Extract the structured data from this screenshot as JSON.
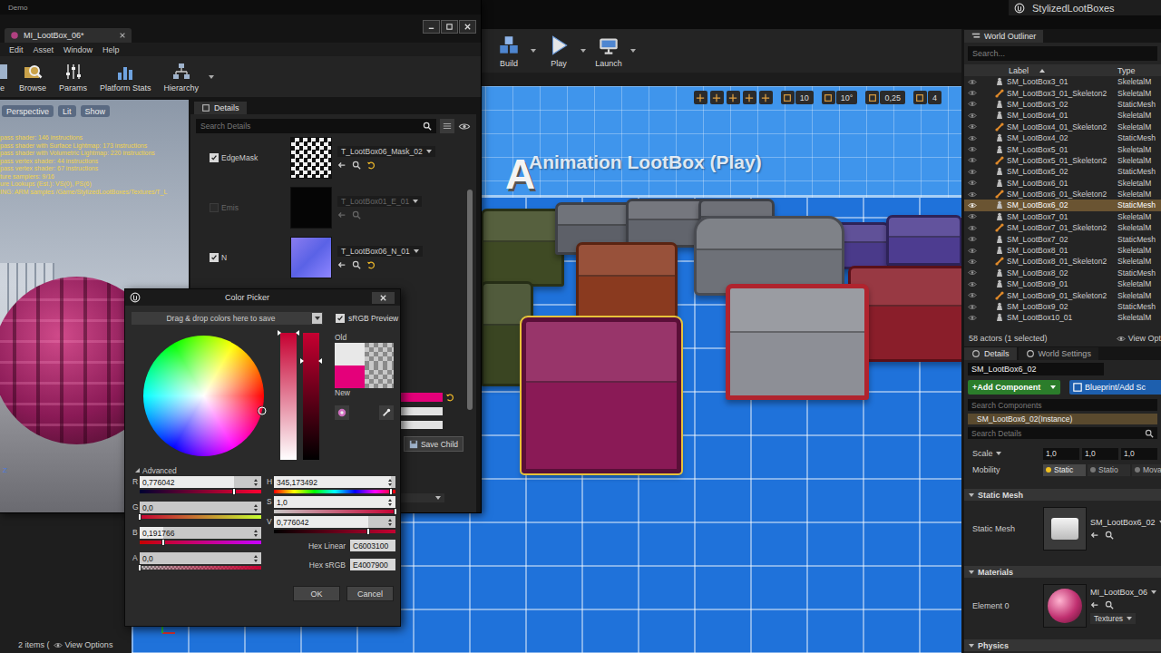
{
  "editor": {
    "project": "StylizedLootBoxes"
  },
  "toolbar": [
    {
      "label": "Build"
    },
    {
      "label": "Play"
    },
    {
      "label": "Launch"
    }
  ],
  "viewport": {
    "snap_values": [
      "10",
      "10°",
      "0,25",
      "4"
    ],
    "scene_title": "Animation LootBox (Play)",
    "scene_letter": "A"
  },
  "content_browser": {
    "item_count": "2 items (",
    "view_options": "View Options"
  },
  "material_editor": {
    "window_title": "Demo",
    "tab": "MI_LootBox_06*",
    "menu": [
      "Edit",
      "Asset",
      "Window",
      "Help"
    ],
    "tools": [
      {
        "label": "e"
      },
      {
        "label": "Browse"
      },
      {
        "label": "Params"
      },
      {
        "label": "Platform Stats"
      },
      {
        "label": "Hierarchy"
      }
    ],
    "preview_buttons": [
      "Perspective",
      "Lit",
      "Show"
    ],
    "stats": [
      "pass shader: 146 instructions",
      "pass shader with Surface Lightmap: 173 instructions",
      "pass shader with Volumetric Lightmap: 220 instructions",
      "pass vertex shader: 44 instructions",
      "pass vertex shader: 67 instructions",
      "ture samplers: 9/16",
      "ure Lookups (Est.): VS(0), PS(6)",
      "ING: ARM samples /Game/StylizedLootBoxes/Textures/T_L"
    ],
    "axis_label": "Z",
    "details": {
      "tab": "Details",
      "search_placeholder": "Search Details",
      "params": [
        {
          "name": "EdgeMask",
          "checked": true,
          "enabled": true,
          "overridden": true,
          "texture": "T_LootBox06_Mask_02",
          "kind": "mask"
        },
        {
          "name": "Emis",
          "checked": false,
          "enabled": false,
          "overridden": false,
          "texture": "T_LootBox01_E_01",
          "kind": "emissive"
        },
        {
          "name": "N",
          "checked": true,
          "enabled": true,
          "overridden": true,
          "texture": "T_LootBox06_N_01",
          "kind": "normal"
        }
      ],
      "save_child": "Save Child"
    }
  },
  "color_picker": {
    "title": "Color Picker",
    "preset_hint": "Drag & drop colors here to save",
    "srgb_preview": {
      "label": "sRGB Preview",
      "checked": true
    },
    "wheel": {
      "hue": 0.959,
      "saturation": 1.0
    },
    "saturation_slider": {
      "level": 1.0
    },
    "value_slider": {
      "level": 0.776
    },
    "swatches": [
      {
        "label": "Old",
        "color": "#e8e8e8"
      },
      {
        "label": "New",
        "color": "#e4007a"
      }
    ],
    "advanced": {
      "label": "Advanced",
      "expanded": true,
      "rgba": [
        {
          "label": "R",
          "value": "0,776042",
          "level": 0.776
        },
        {
          "label": "G",
          "value": "0,0",
          "level": 0.0
        },
        {
          "label": "B",
          "value": "0,191766",
          "level": 0.192
        },
        {
          "label": "A",
          "value": "0,0",
          "level": 0.0
        }
      ],
      "hsv": [
        {
          "label": "H",
          "value": "345,173492",
          "level": 0.959
        },
        {
          "label": "S",
          "value": "1,0",
          "level": 1.0
        },
        {
          "label": "V",
          "value": "0,776042",
          "level": 0.776
        }
      ],
      "hex": [
        {
          "label": "Hex Linear",
          "value": "C6003100"
        },
        {
          "label": "Hex sRGB",
          "value": "E4007900"
        }
      ]
    },
    "buttons": [
      "OK",
      "Cancel"
    ]
  },
  "outliner": {
    "tab": "World Outliner",
    "search_placeholder": "Search...",
    "columns": [
      "Label",
      "Type"
    ],
    "rows": [
      {
        "label": "SM_LootBox3_01",
        "type": "SkeletalM",
        "kind": "actor",
        "selected": false
      },
      {
        "label": "SM_LootBox3_01_Skeleton2",
        "type": "SkeletalM",
        "kind": "skeleton",
        "selected": false
      },
      {
        "label": "SM_LootBox3_02",
        "type": "StaticMesh",
        "kind": "actor",
        "selected": false
      },
      {
        "label": "SM_LootBox4_01",
        "type": "SkeletalM",
        "kind": "actor",
        "selected": false
      },
      {
        "label": "SM_LootBox4_01_Skeleton2",
        "type": "SkeletalM",
        "kind": "skeleton",
        "selected": false
      },
      {
        "label": "SM_LootBox4_02",
        "type": "StaticMesh",
        "kind": "actor",
        "selected": false
      },
      {
        "label": "SM_LootBox5_01",
        "type": "SkeletalM",
        "kind": "actor",
        "selected": false
      },
      {
        "label": "SM_LootBox5_01_Skeleton2",
        "type": "SkeletalM",
        "kind": "skeleton",
        "selected": false
      },
      {
        "label": "SM_LootBox5_02",
        "type": "StaticMesh",
        "kind": "actor",
        "selected": false
      },
      {
        "label": "SM_LootBox6_01",
        "type": "SkeletalM",
        "kind": "actor",
        "selected": false
      },
      {
        "label": "SM_LootBox6_01_Skeleton2",
        "type": "SkeletalM",
        "kind": "skeleton",
        "selected": false
      },
      {
        "label": "SM_LootBox6_02",
        "type": "StaticMesh",
        "kind": "actor",
        "selected": true
      },
      {
        "label": "SM_LootBox7_01",
        "type": "SkeletalM",
        "kind": "actor",
        "selected": false
      },
      {
        "label": "SM_LootBox7_01_Skeleton2",
        "type": "SkeletalM",
        "kind": "skeleton",
        "selected": false
      },
      {
        "label": "SM_LootBox7_02",
        "type": "StaticMesh",
        "kind": "actor",
        "selected": false
      },
      {
        "label": "SM_LootBox8_01",
        "type": "SkeletalM",
        "kind": "actor",
        "selected": false
      },
      {
        "label": "SM_LootBox8_01_Skeleton2",
        "type": "SkeletalM",
        "kind": "skeleton",
        "selected": false
      },
      {
        "label": "SM_LootBox8_02",
        "type": "StaticMesh",
        "kind": "actor",
        "selected": false
      },
      {
        "label": "SM_LootBox9_01",
        "type": "SkeletalM",
        "kind": "actor",
        "selected": false
      },
      {
        "label": "SM_LootBox9_01_Skeleton2",
        "type": "SkeletalM",
        "kind": "skeleton",
        "selected": false
      },
      {
        "label": "SM_LootBox9_02",
        "type": "StaticMesh",
        "kind": "actor",
        "selected": false
      },
      {
        "label": "SM_LootBox10_01",
        "type": "SkeletalM",
        "kind": "actor",
        "selected": false
      }
    ],
    "footer": "58 actors (1 selected)",
    "view_options": "View Opt"
  },
  "details": {
    "tabs": [
      {
        "label": "Details",
        "selected": true
      },
      {
        "label": "World Settings",
        "selected": false
      }
    ],
    "name": "SM_LootBox6_02",
    "add_component": "+Add Component",
    "blueprint": "Blueprint/Add Sc",
    "search_components": "Search Components",
    "instance": "SM_LootBox6_02(Instance)",
    "search_details": "Search Details",
    "scale": {
      "label": "Scale",
      "values": [
        "1,0",
        "1,0",
        "1,0"
      ]
    },
    "mobility": {
      "label": "Mobility",
      "options": [
        {
          "label": "Static",
          "selected": true
        },
        {
          "label": "Statio",
          "selected": false
        },
        {
          "label": "Mova",
          "selected": false
        }
      ]
    },
    "static_mesh": {
      "header": "Static Mesh",
      "label": "Static Mesh",
      "asset": "SM_LootBox6_02"
    },
    "materials": {
      "header": "Materials",
      "label": "Element 0",
      "asset": "MI_LootBox_06",
      "dropdown": "Textures"
    },
    "physics": {
      "header": "Physics"
    }
  }
}
